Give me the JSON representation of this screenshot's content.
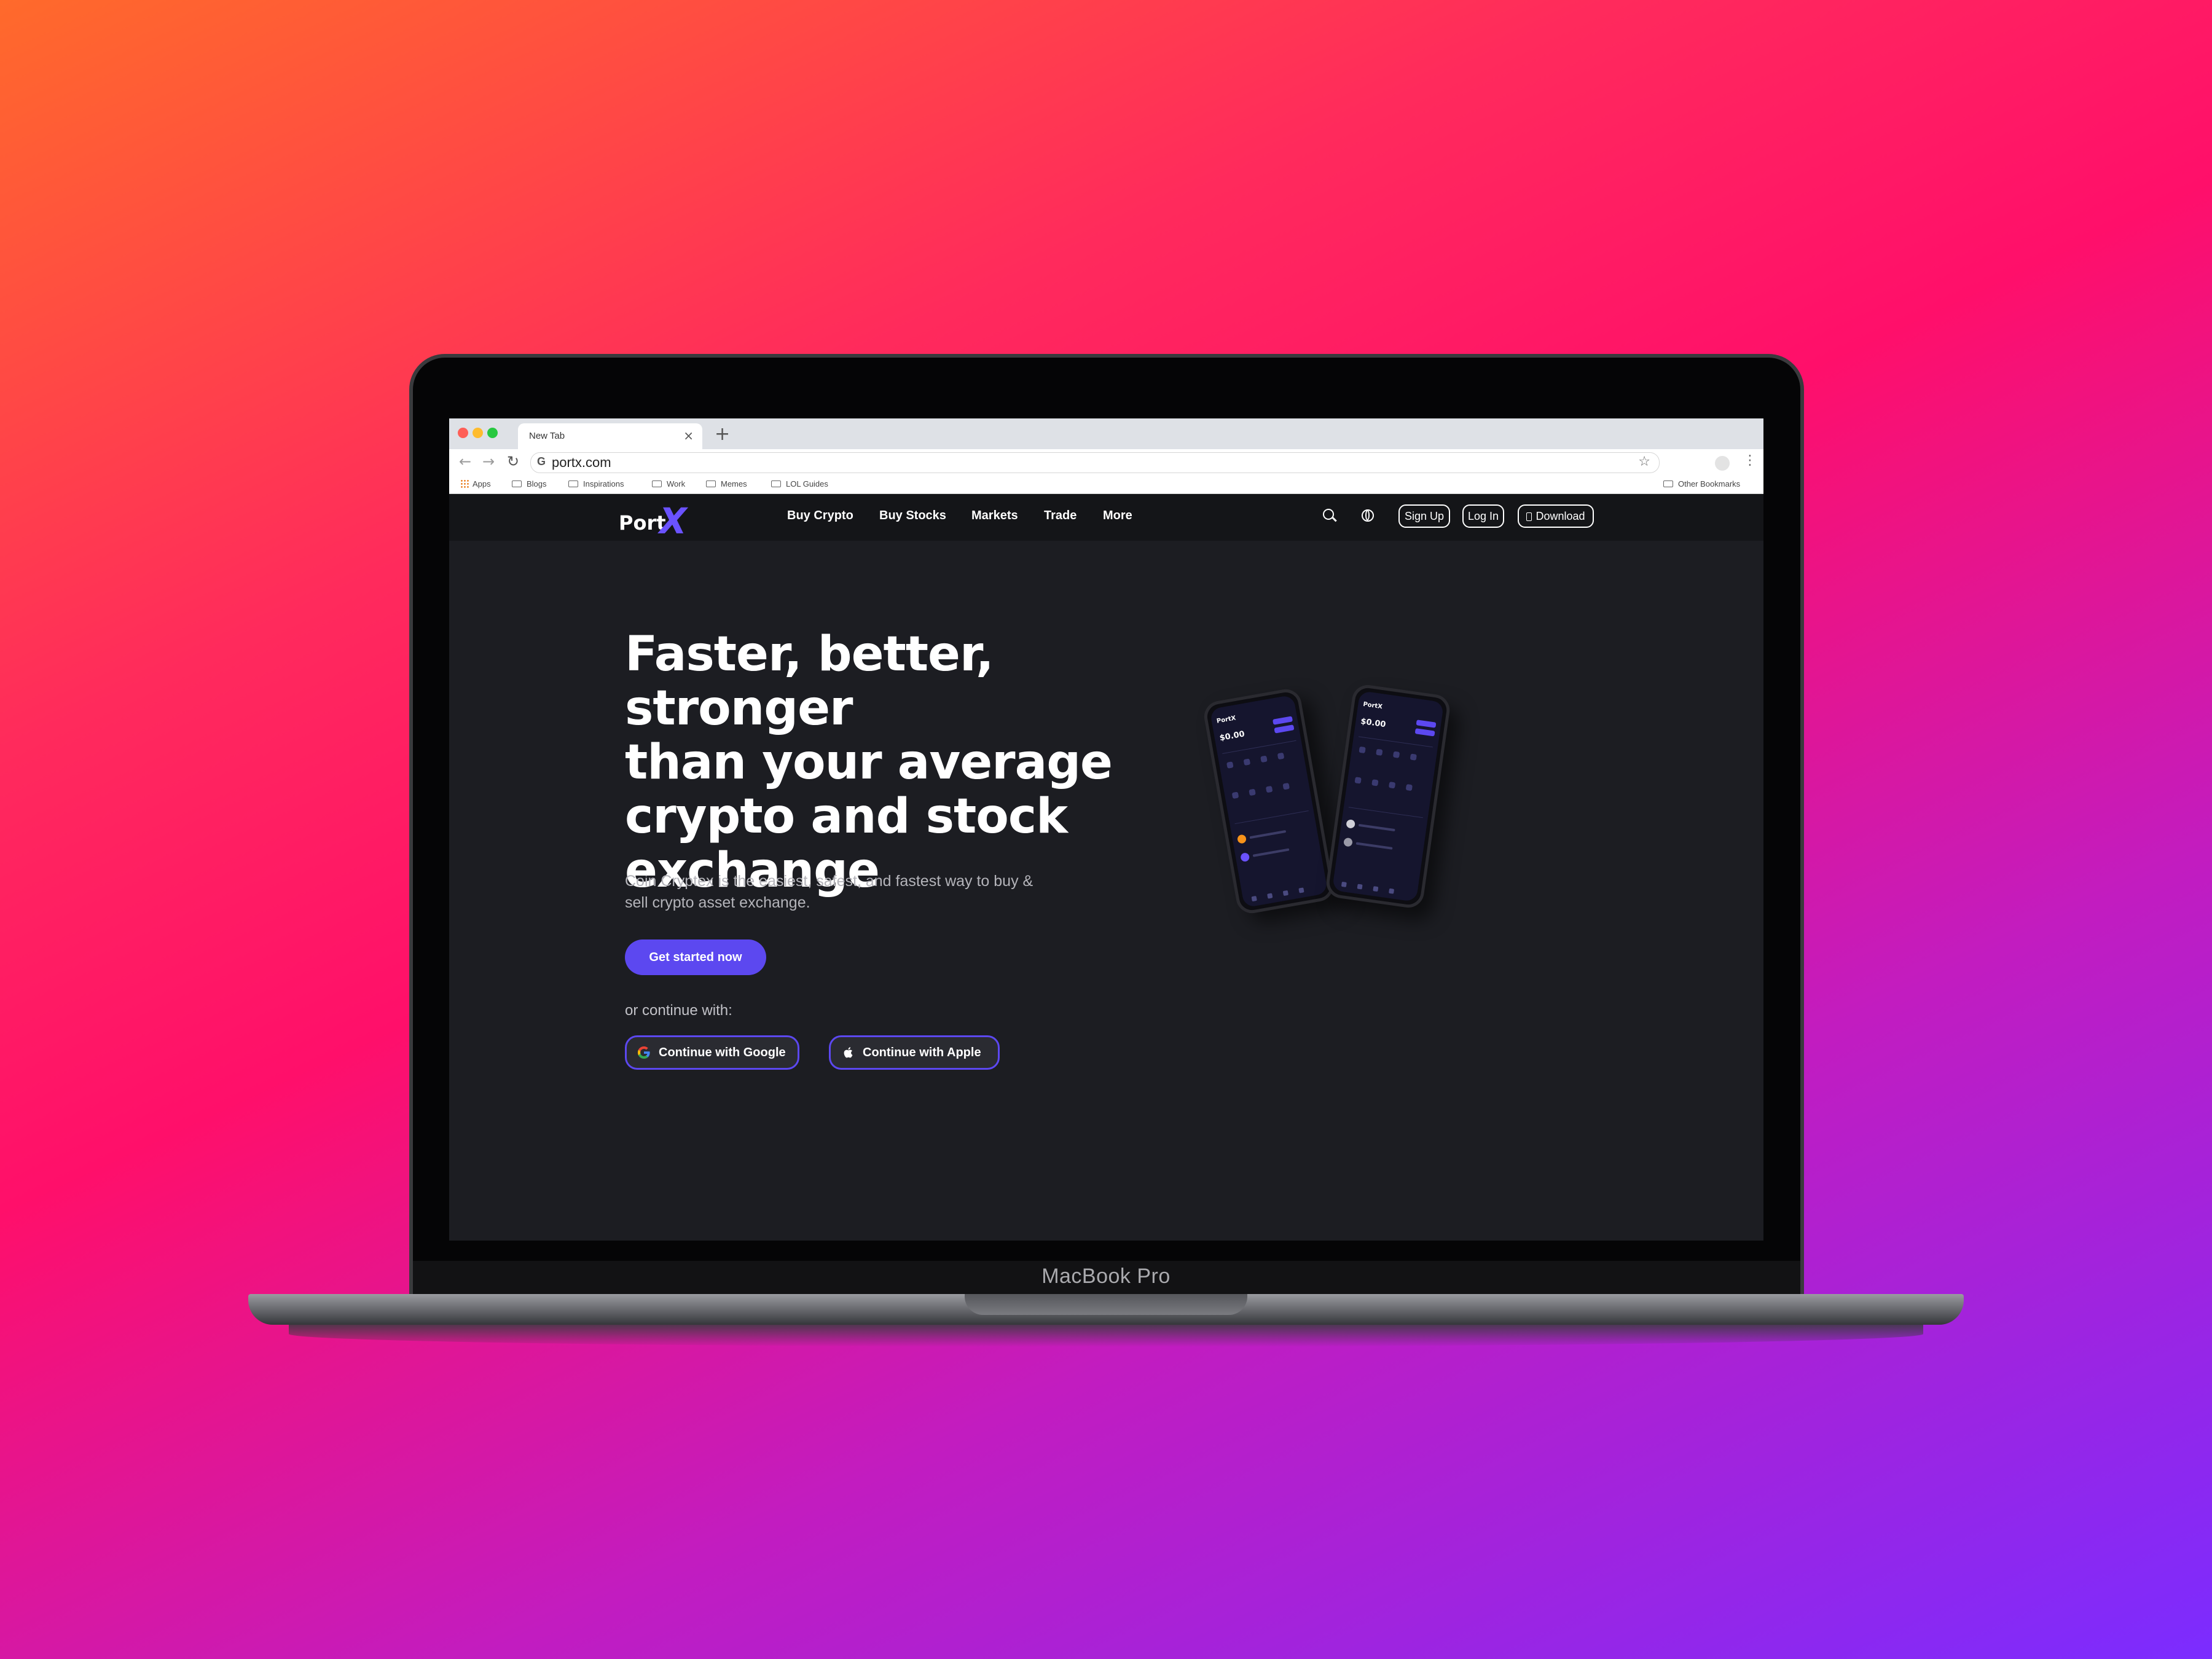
{
  "device": {
    "model_label": "MacBook Pro"
  },
  "browser": {
    "tab_title": "New Tab",
    "tab_close": "×",
    "new_tab": "+",
    "url": "portx.com",
    "address_icon_letter": "G",
    "back_icon": "←",
    "forward_icon": "→",
    "reload_icon": "↻",
    "star_icon": "☆",
    "menu_icon": "⋮",
    "bookmarks": [
      "Apps",
      "Blogs",
      "Inspirations",
      "Work",
      "Memes",
      "LOL Guides"
    ],
    "other_bookmarks": "Other Bookmarks"
  },
  "site": {
    "logo_text": "Port",
    "logo_mark": "X",
    "nav_links": [
      "Buy Crypto",
      "Buy Stocks",
      "Markets",
      "Trade",
      "More"
    ],
    "sign_up": "Sign Up",
    "log_in": "Log In",
    "download": "Download",
    "hero_title_lines": [
      "Faster, better, stronger",
      "than your average",
      "crypto and stock",
      "exchange"
    ],
    "hero_subtitle_lines": [
      "Coin Cryptex is the easiest, safest, and fastest way to buy &",
      "sell crypto asset exchange."
    ],
    "cta_label": "Get started now",
    "or_continue": "or continue with:",
    "google_button": "Continue with Google",
    "apple_button": "Continue with Apple",
    "phone_brand": "PortX",
    "phone_balance": "$0.00"
  },
  "colors": {
    "accent": "#5c48f0",
    "site_bg": "#1c1d22",
    "nav_bg": "#141518"
  }
}
